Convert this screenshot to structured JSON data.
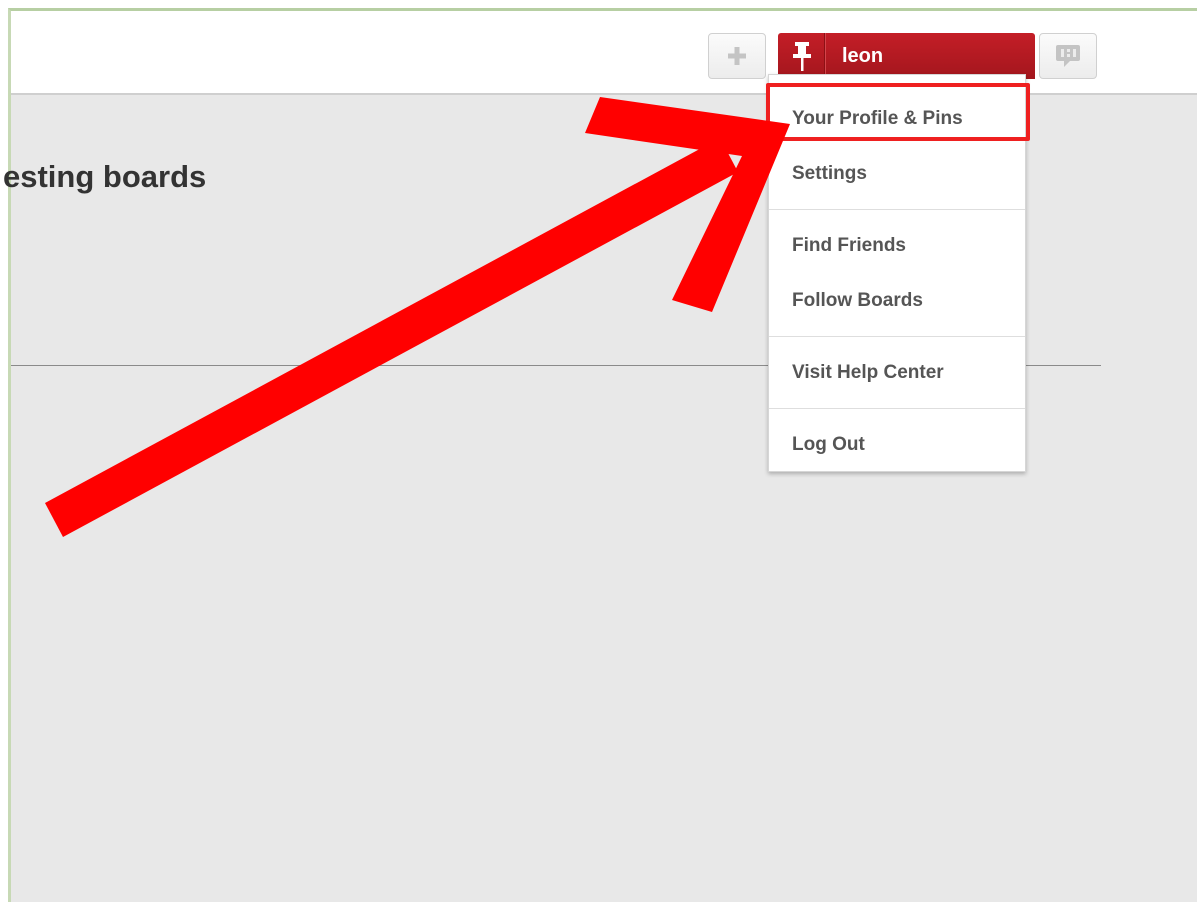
{
  "header": {
    "username": "leon",
    "icons": {
      "add": "plus-icon",
      "pin": "pushpin-icon",
      "notifications": "speech-bubble-icon"
    }
  },
  "main": {
    "heading": "esting boards"
  },
  "dropdown": {
    "items": [
      {
        "label": "Your Profile & Pins"
      },
      {
        "label": "Settings"
      },
      {
        "label": "Find Friends"
      },
      {
        "label": "Follow Boards"
      },
      {
        "label": "Visit Help Center"
      },
      {
        "label": "Log Out"
      }
    ]
  },
  "annotation": {
    "arrow_color": "#ff0000",
    "highlight_color": "#ef2020"
  },
  "colors": {
    "brand_red": "#c41e27",
    "background": "#e8e8e8"
  }
}
